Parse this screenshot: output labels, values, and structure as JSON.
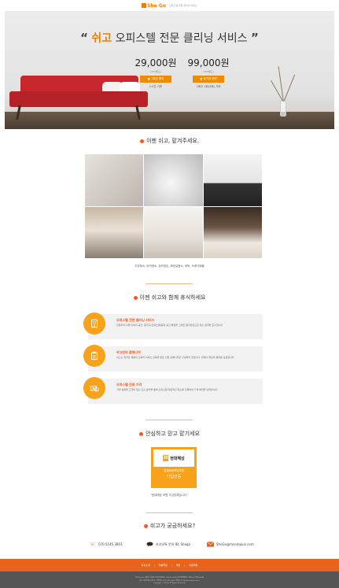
{
  "header": {
    "logo": "She Go",
    "tagline": "오피스텔 전문 클리닝 서비스"
  },
  "hero": {
    "title_quote_open": "“",
    "title_brand": "쉬고",
    "title_rest": " 오피스텔 전문 클리닝 서비스",
    "title_quote_close": "”",
    "plans": [
      {
        "price": "29,000원",
        "vat": "(VAT별도)",
        "button": "1회권 예약",
        "note": "2시간 기준"
      },
      {
        "price": "99,000원",
        "vat": "(VAT별도)",
        "button": "정기권 예약",
        "note": "1회주 1회(4회) 기준"
      }
    ]
  },
  "section1": {
    "title": "이젠 쉬고, 맡겨주세요.",
    "services": "주방청소, 바닥청소, 정리정돈, 화장실청소, 세탁, 쓰레기배출"
  },
  "section2": {
    "title": "이젠 쉬고와 함께 휴식하세요",
    "features": [
      {
        "title": "오피스텔 전문 클리닝 서비스",
        "desc": "전문주의 이행 이외의 공간, 원가구(오피스텔)등의 공간 특징을 고려한 원키트만으로 청소 원칙을 준수합니다."
      },
      {
        "title": "쉬고만의 홈매니저",
        "desc": "쉬고는 철저한 채용과 교육과 서비스 교육을 받은 전문 홈매니저로 구성되어 있습니다. 언제나 최상의 결과를 보장합니다."
      },
      {
        "title": "오피스텔 전용 가격",
        "desc": "가격 설정을 고객의 청소 요소 분석을 통해 오피스텔 전문적인 청소를 진행하여 가격 부담을 낮췄습니다."
      }
    ]
  },
  "section3": {
    "title": "안심하고 믿고 맡기세요",
    "badge_company": "현대해상",
    "badge_line1": "영업배상책임보험",
    "badge_line2": "가입인증",
    "note": "\"현대해상 보험 가입업체입니다.\""
  },
  "section4": {
    "title": "쉬고가 궁금하세요?",
    "phone": "070.5145.3803",
    "kakao": "카카오톡 문의 ID: Shego",
    "email": "SheGo@mcompius.com"
  },
  "footer": {
    "nav": [
      "회사소개",
      "이용약관",
      "개인",
      "이용약관"
    ],
    "info_lines": [
      "쉬고(SheGo) 대표자: 홍길동  사업자등록번호: 000-00-00000  통신판매업신고: 제0000-서울-0000호",
      "주소: 서울특별시 강남구  고객센터: 070.5145.3803  이메일: SheGo@mcompius.com",
      "Copyright © SheGo. All Rights Reserved."
    ]
  },
  "colors": {
    "accent": "#f05a22",
    "button": "#f08a00",
    "icon": "#f7a21b",
    "footer_nav": "#e8641c",
    "footer_info": "#555555"
  }
}
